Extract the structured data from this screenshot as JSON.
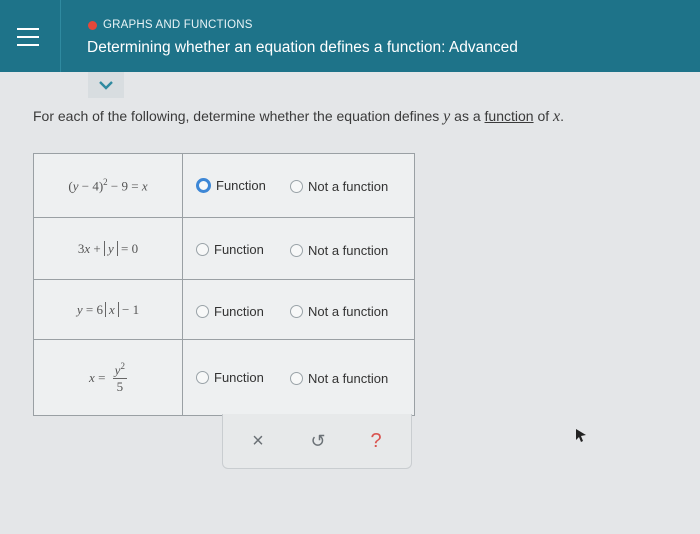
{
  "header": {
    "topic": "GRAPHS AND FUNCTIONS",
    "title": "Determining whether an equation defines a function: Advanced",
    "topic_dot_color": "#e5483a",
    "bg_color": "#1e7389"
  },
  "instruction": {
    "prefix": "For each of the following, determine whether the equation defines ",
    "var_y": "y",
    "as_a": " as a ",
    "link": "function",
    "of": " of ",
    "var_x": "x",
    "period": "."
  },
  "rows": [
    {
      "equation": "(y − 4)^2 − 9 = x",
      "option_function": "Function",
      "option_not": "Not a function",
      "selected": "function"
    },
    {
      "equation": "3x + |y| = 0",
      "option_function": "Function",
      "option_not": "Not a function",
      "selected": null
    },
    {
      "equation": "y = 6|x| − 1",
      "option_function": "Function",
      "option_not": "Not a function",
      "selected": null
    },
    {
      "equation": "x = y^2 / 5",
      "option_function": "Function",
      "option_not": "Not a function",
      "selected": null
    }
  ],
  "eq_parts": {
    "r1": {
      "open": "(",
      "y": "y",
      "minus4": " − 4)",
      "sup": "2",
      "rest": " − 9 = ",
      "x": "x"
    },
    "r2": {
      "coef": "3",
      "x": "x",
      "plus": " + ",
      "y": "y",
      "rest": " = 0"
    },
    "r3": {
      "y": "y",
      "eq": " = 6",
      "x": "x",
      "rest": " − 1"
    },
    "r4": {
      "x": "x",
      "eq": " = ",
      "num": "y",
      "sup": "2",
      "den": "5"
    }
  },
  "actions": {
    "clear": "×",
    "undo": "↺",
    "help": "?"
  },
  "icons": [
    "menu-icon",
    "chevron-down-icon",
    "clear-icon",
    "undo-icon",
    "help-icon",
    "cursor-icon"
  ],
  "colors": {
    "selected_radio": "#3d87d6",
    "help": "#d9534f"
  }
}
